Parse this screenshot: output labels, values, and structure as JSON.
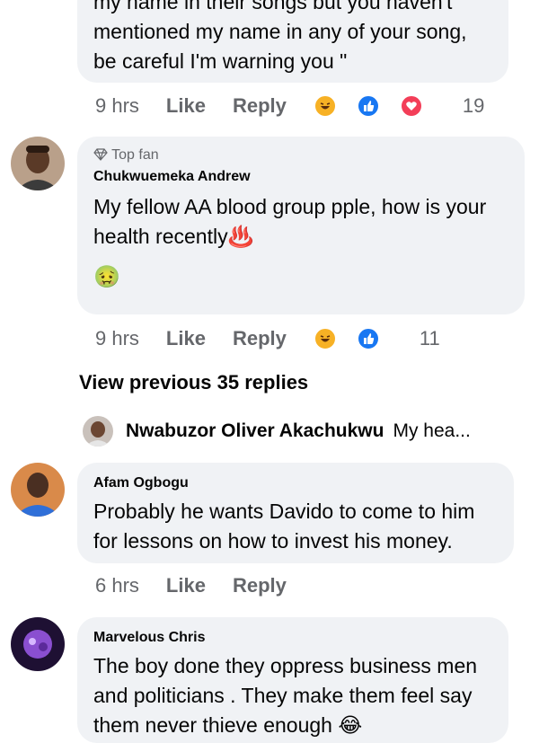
{
  "comments": [
    {
      "id": "c0",
      "text_lines": [
        "my name in their songs but you haven't",
        "mentioned my name in any of your song,",
        "be careful I'm warning you \""
      ],
      "time": "9 hrs",
      "like": "Like",
      "reply": "Reply",
      "reaction_count": "19",
      "reactions": [
        "haha-icon",
        "like-icon",
        "love-icon"
      ]
    },
    {
      "id": "c1",
      "badge": "Top fan",
      "author": "Chukwuemeka Andrew",
      "text_lines": [
        "My fellow AA blood group pple, how is your",
        "health recently♨️"
      ],
      "emoji": "🤢",
      "time": "9 hrs",
      "like": "Like",
      "reply": "Reply",
      "reaction_count": "11",
      "reactions": [
        "haha-icon",
        "like-icon"
      ]
    },
    {
      "id": "c2",
      "author": "Afam Ogbogu",
      "text_lines": [
        "Probably he wants Davido to come to him",
        "for lessons on how to invest his money."
      ],
      "time": "6 hrs",
      "like": "Like",
      "reply": "Reply"
    },
    {
      "id": "c3",
      "author": "Marvelous Chris",
      "text_lines": [
        "The boy done they oppress business men",
        "and politicians . They make them feel say",
        "them never thieve enough 😂"
      ]
    }
  ],
  "view_previous": "View previous 35 replies",
  "reply_preview": {
    "author": "Nwabuzor Oliver Akachukwu",
    "text": "My hea..."
  },
  "colors": {
    "bubble": "#f0f2f5",
    "meta": "#65676b",
    "text": "#050505"
  }
}
